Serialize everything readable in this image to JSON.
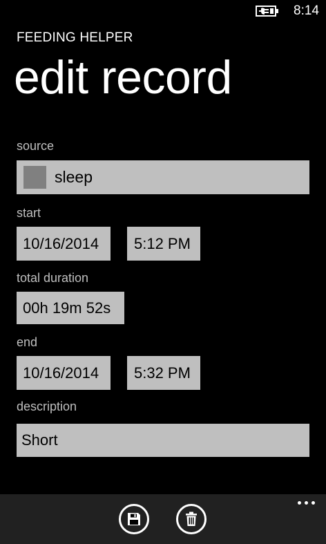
{
  "status_bar": {
    "time": "8:14",
    "battery_icon": "battery-charging-icon"
  },
  "header": {
    "app_title": "FEEDING HELPER",
    "page_title": "edit record"
  },
  "form": {
    "source": {
      "label": "source",
      "value": "sleep",
      "swatch_color": "#808080"
    },
    "start": {
      "label": "start",
      "date": "10/16/2014",
      "time": "5:12 PM"
    },
    "total_duration": {
      "label": "total duration",
      "value": "00h 19m 52s"
    },
    "end": {
      "label": "end",
      "date": "10/16/2014",
      "time": "5:32 PM"
    },
    "description": {
      "label": "description",
      "value": "Short"
    }
  },
  "app_bar": {
    "buttons": [
      {
        "icon": "save-icon"
      },
      {
        "icon": "delete-icon"
      }
    ],
    "more_icon": "ellipsis-icon"
  },
  "colors": {
    "background": "#000000",
    "field_background": "#bfbfbf",
    "app_bar_background": "#212121",
    "label_color": "#bfbfbf"
  }
}
